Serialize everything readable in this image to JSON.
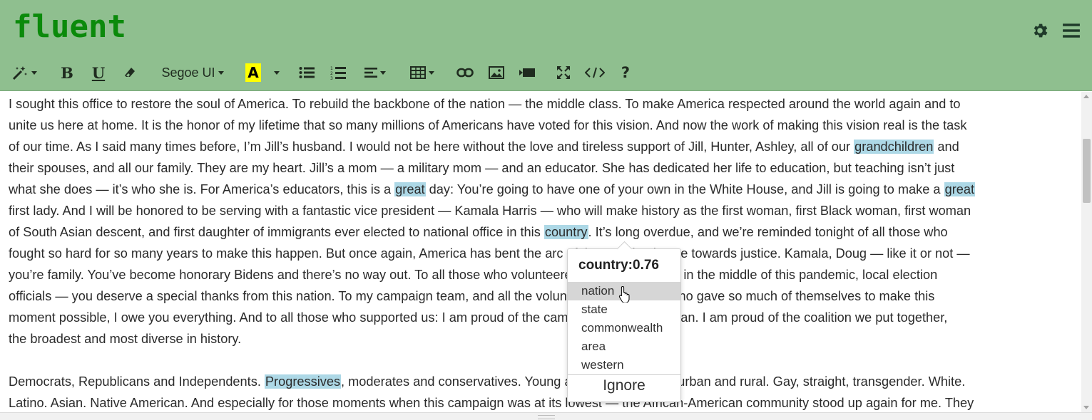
{
  "app": {
    "logo": "fluent"
  },
  "toolbar": {
    "font": "Segoe UI",
    "icons": [
      "magic-wand",
      "bold",
      "underline",
      "eraser",
      "font-dropdown",
      "font-color",
      "unordered-list",
      "ordered-list",
      "align",
      "table",
      "link",
      "image",
      "video",
      "fullscreen",
      "code-view",
      "help"
    ]
  },
  "colors": {
    "header": "#8fbf8f",
    "logo": "#0b8a0b",
    "highlight": "#add8e6"
  },
  "editor": {
    "para1_lines": [
      "I sought this office to restore the soul of America. To rebuild the backbone of the nation — the middle class. To make America respected around the world again and to",
      "unite us here at home. It is the honor of my lifetime that so many millions of Americans have voted for this vision. And now the work of making this vision real is the task",
      [
        "of our time. As I said many times before, I’m Jill’s husband. I would not be here without the love and tireless support of Jill, Hunter, Ashley, all of our ",
        "grandchildren",
        " and"
      ],
      "their spouses, and all our family. They are my heart. Jill’s a mom — a military mom — and an educator. She has dedicated her life to education, but teaching isn’t just",
      [
        "what she does — it’s who she is. For America’s educators, this is a ",
        "great",
        " day: You’re going to have one of your own in the White House, and Jill is going to make a ",
        "great"
      ],
      "first lady. And I will be honored to be serving with a fantastic vice president — Kamala Harris — who will make history as the first woman, first Black woman, first woman",
      [
        "of South Asian descent, and first daughter of immigrants ever elected to national office in this ",
        "country",
        ". It’s long overdue, and we’re reminded tonight of all those who"
      ],
      "fought so hard for so many years to make this happen. But once again, America has bent the arc of the moral universe towards justice. Kamala, Doug — like it or not —",
      "you’re family. You’ve become honorary Bidens and there’s no way out. To all those who volunteered, worked the polls in the middle of this pandemic, local election",
      "officials — you deserve a special thanks from this nation. To my campaign team, and all the volunteers, to all those who gave so much of themselves to make this",
      "moment possible, I owe you everything. And to all those who supported us: I am proud of the campaign we built and ran. I am proud of the coalition we put together,",
      "the broadest and most diverse in history."
    ],
    "para2_lines": [
      [
        "Democrats, Republicans and Independents. ",
        "Progressives",
        ", moderates and conservatives. Young and old. Urban, suburban and rural. Gay, straight, transgender. White."
      ],
      "Latino. Asian. Native American. And especially for those moments when this campaign was at its lowest — the African-American community stood up again for me. They"
    ]
  },
  "popup": {
    "title": "country:0.76",
    "suggestions": [
      "nation",
      "state",
      "commonwealth",
      "area",
      "western"
    ],
    "active_index": 0,
    "ignore_label": "Ignore"
  }
}
